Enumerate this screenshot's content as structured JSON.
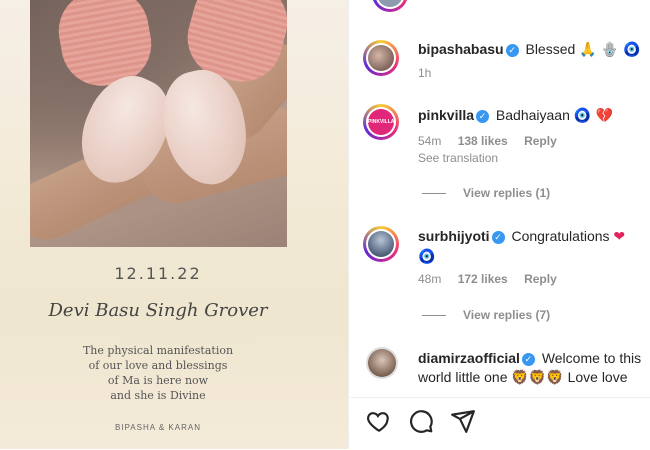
{
  "post": {
    "date": "12.11.22",
    "name": "Devi Basu Singh Grover",
    "message": [
      "The physical manifestation",
      "of our love and blessings",
      "of Ma is here now",
      "and she is Divine"
    ],
    "signature": "BIPASHA & KARAN"
  },
  "comments": [
    {
      "username": "bipashabasu",
      "text": "Blessed",
      "emoji": "🙏 🪬 🧿",
      "time": "1h"
    },
    {
      "username": "pinkvilla",
      "avatar_text": "PINKVILLA",
      "text": "Badhaiyaan",
      "emoji": "🧿 💔",
      "time": "54m",
      "likes": "138 likes",
      "reply": "Reply",
      "see_translation": "See translation",
      "view_replies": "View replies (1)"
    },
    {
      "username": "surbhijyoti",
      "text": "Congratulations",
      "emoji": "❤",
      "emoji2": "🧿",
      "time": "48m",
      "likes": "172 likes",
      "reply": "Reply",
      "view_replies": "View replies (7)"
    },
    {
      "username": "diamirzaofficial",
      "text": "Welcome to this",
      "text2": "world little one",
      "emoji": "🦁🦁🦁",
      "text3": "Love love"
    }
  ],
  "actions": {
    "like_icon": "heart-icon",
    "comment_icon": "comment-icon",
    "share_icon": "share-icon"
  }
}
